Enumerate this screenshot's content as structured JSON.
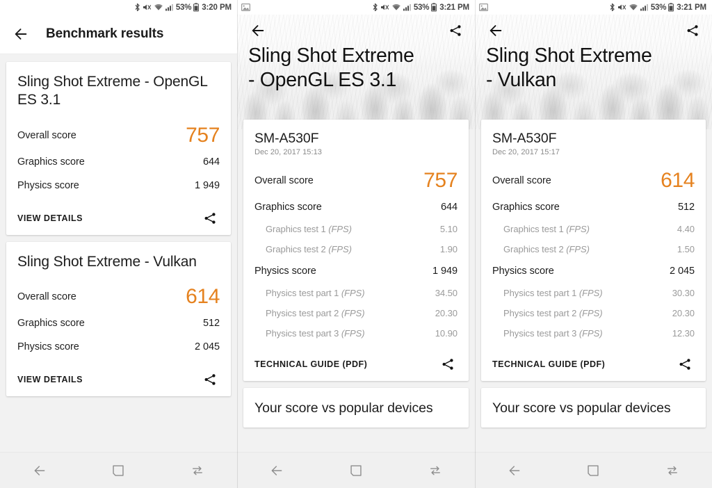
{
  "meta": {
    "orange": "#e5821f",
    "page_bg": "#f2f2f2"
  },
  "status_bar": {
    "panel_a": {
      "notification_icons": [],
      "icons": [
        "bluetooth-icon",
        "mute-icon",
        "wifi-icon",
        "signal-icon"
      ],
      "battery": "53%",
      "time": "3:20 PM"
    },
    "panel_b": {
      "notification_icons": [
        "screenshot-icon"
      ],
      "icons": [
        "bluetooth-icon",
        "mute-icon",
        "wifi-icon",
        "signal-icon"
      ],
      "battery": "53%",
      "time": "3:21 PM"
    },
    "panel_c": {
      "notification_icons": [
        "screenshot-icon"
      ],
      "icons": [
        "bluetooth-icon",
        "mute-icon",
        "wifi-icon",
        "signal-icon"
      ],
      "battery": "53%",
      "time": "3:21 PM"
    }
  },
  "nav_bar": {
    "back_label": "back-icon",
    "home_label": "recents-square-icon",
    "recents_label": "swap-arrows-icon"
  },
  "panel_a": {
    "appbar": {
      "title": "Benchmark results",
      "back_icon": "back-arrow-icon"
    },
    "cards": [
      {
        "title": "Sling Shot Extreme - OpenGL ES 3.1",
        "rows": [
          {
            "label": "Overall score",
            "value": "757",
            "kind": "overall"
          },
          {
            "label": "Graphics score",
            "value": "644",
            "kind": "normal"
          },
          {
            "label": "Physics score",
            "value": "1 949",
            "kind": "normal"
          }
        ],
        "action": "VIEW DETAILS",
        "share_icon": "share-icon"
      },
      {
        "title": "Sling Shot Extreme - Vulkan",
        "rows": [
          {
            "label": "Overall score",
            "value": "614",
            "kind": "overall"
          },
          {
            "label": "Graphics score",
            "value": "512",
            "kind": "normal"
          },
          {
            "label": "Physics score",
            "value": "2 045",
            "kind": "normal"
          }
        ],
        "action": "VIEW DETAILS",
        "share_icon": "share-icon"
      }
    ]
  },
  "panel_b": {
    "hero": {
      "title": "Sling Shot Extreme\n- OpenGL ES 3.1",
      "back_icon": "back-arrow-icon",
      "share_icon": "share-icon"
    },
    "card": {
      "device": "SM-A530F",
      "date": "Dec 20, 2017 15:13",
      "rows": [
        {
          "label": "Overall score",
          "value": "757",
          "kind": "overall"
        },
        {
          "label": "Graphics score",
          "value": "644",
          "kind": "group"
        },
        {
          "label": "Graphics test 1",
          "unit": "(FPS)",
          "value": "5.10",
          "kind": "sub"
        },
        {
          "label": "Graphics test 2",
          "unit": "(FPS)",
          "value": "1.90",
          "kind": "sub"
        },
        {
          "label": "Physics score",
          "value": "1 949",
          "kind": "group"
        },
        {
          "label": "Physics test part 1",
          "unit": "(FPS)",
          "value": "34.50",
          "kind": "sub"
        },
        {
          "label": "Physics test part 2",
          "unit": "(FPS)",
          "value": "20.30",
          "kind": "sub"
        },
        {
          "label": "Physics test part 3",
          "unit": "(FPS)",
          "value": "10.90",
          "kind": "sub"
        }
      ],
      "action": "TECHNICAL GUIDE (PDF)",
      "share_icon": "share-icon"
    },
    "next_card": {
      "title": "Your score vs popular devices"
    }
  },
  "panel_c": {
    "hero": {
      "title": "Sling Shot Extreme\n- Vulkan",
      "back_icon": "back-arrow-icon",
      "share_icon": "share-icon"
    },
    "card": {
      "device": "SM-A530F",
      "date": "Dec 20, 2017 15:17",
      "rows": [
        {
          "label": "Overall score",
          "value": "614",
          "kind": "overall"
        },
        {
          "label": "Graphics score",
          "value": "512",
          "kind": "group"
        },
        {
          "label": "Graphics test 1",
          "unit": "(FPS)",
          "value": "4.40",
          "kind": "sub"
        },
        {
          "label": "Graphics test 2",
          "unit": "(FPS)",
          "value": "1.50",
          "kind": "sub"
        },
        {
          "label": "Physics score",
          "value": "2 045",
          "kind": "group"
        },
        {
          "label": "Physics test part 1",
          "unit": "(FPS)",
          "value": "30.30",
          "kind": "sub"
        },
        {
          "label": "Physics test part 2",
          "unit": "(FPS)",
          "value": "20.30",
          "kind": "sub"
        },
        {
          "label": "Physics test part 3",
          "unit": "(FPS)",
          "value": "12.30",
          "kind": "sub"
        }
      ],
      "action": "TECHNICAL GUIDE (PDF)",
      "share_icon": "share-icon"
    },
    "next_card": {
      "title": "Your score vs popular devices"
    }
  }
}
